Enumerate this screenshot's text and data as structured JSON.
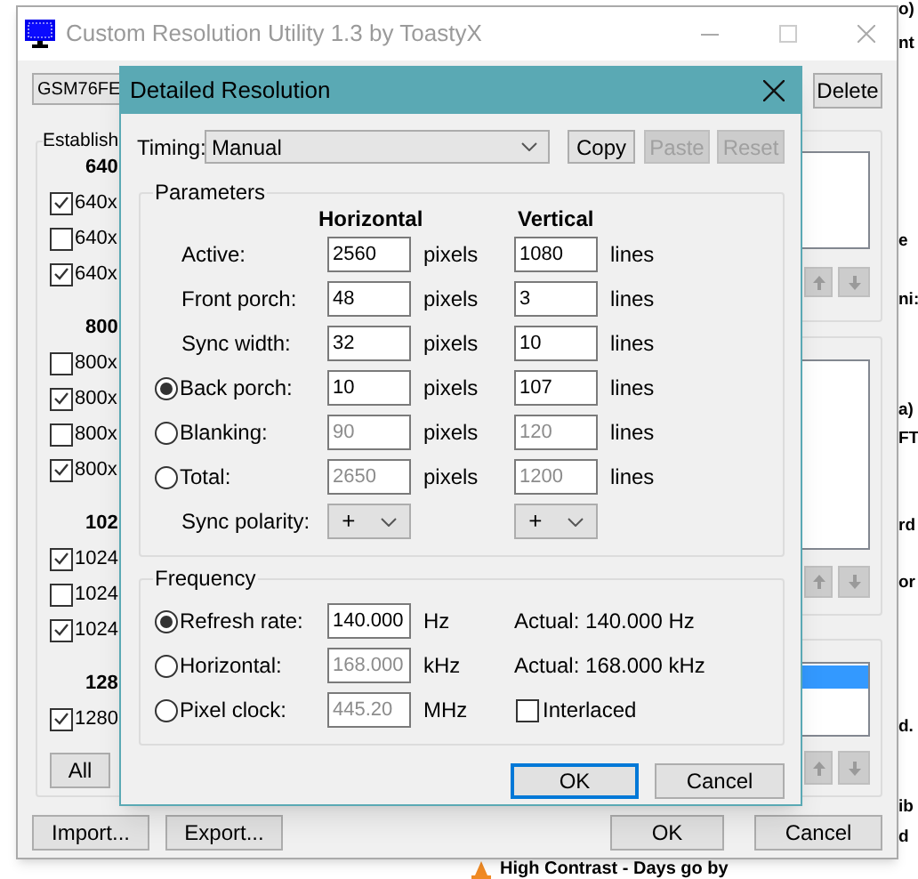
{
  "background_page": {
    "fragments": [
      "o)",
      "nt",
      "e",
      "ni:",
      "a)",
      "FT",
      "rd",
      "or",
      "d.",
      "ib",
      "d"
    ],
    "footer": "High Contrast - Days go by"
  },
  "main_window": {
    "title": "Custom Resolution Utility 1.3 by ToastyX",
    "active": false,
    "monitor": "GSM76FE",
    "delete_button": "Delete",
    "established": {
      "label": "Establish",
      "groups": [
        {
          "header": "640",
          "items": [
            {
              "label": "640x",
              "checked": true
            },
            {
              "label": "640x",
              "checked": false
            },
            {
              "label": "640x",
              "checked": true
            }
          ]
        },
        {
          "header": "800",
          "items": [
            {
              "label": "800x",
              "checked": false
            },
            {
              "label": "800x",
              "checked": true
            },
            {
              "label": "800x",
              "checked": false
            },
            {
              "label": "800x",
              "checked": true
            }
          ]
        },
        {
          "header": "102",
          "items": [
            {
              "label": "1024",
              "checked": true
            },
            {
              "label": "1024",
              "checked": false
            },
            {
              "label": "1024",
              "checked": true
            }
          ]
        },
        {
          "header": "128",
          "items": [
            {
              "label": "1280",
              "checked": true
            }
          ]
        }
      ],
      "all_button": "All"
    },
    "lists": [
      {
        "highlighted_row": false
      },
      {
        "highlighted_row": false
      },
      {
        "highlighted_row": true
      }
    ],
    "import_button": "Import...",
    "export_button": "Export...",
    "ok_button": "OK",
    "cancel_button": "Cancel"
  },
  "dialog": {
    "title": "Detailed Resolution",
    "active": true,
    "timing": {
      "label": "Timing:",
      "value": "Manual"
    },
    "buttons": [
      {
        "label": "Copy",
        "disabled": false
      },
      {
        "label": "Paste",
        "disabled": true
      },
      {
        "label": "Reset",
        "disabled": true
      }
    ],
    "parameters": {
      "label": "Parameters",
      "columns": [
        "Horizontal",
        "Vertical"
      ],
      "rows": [
        {
          "kind": "fields",
          "label": "Active:",
          "horizontal": {
            "value": "2560",
            "disabled": false
          },
          "horizontal_unit": "pixels",
          "vertical": {
            "value": "1080",
            "disabled": false
          },
          "vertical_unit": "lines"
        },
        {
          "kind": "fields",
          "label": "Front porch:",
          "horizontal": {
            "value": "48",
            "disabled": false
          },
          "horizontal_unit": "pixels",
          "vertical": {
            "value": "3",
            "disabled": false
          },
          "vertical_unit": "lines"
        },
        {
          "kind": "fields",
          "label": "Sync width:",
          "horizontal": {
            "value": "32",
            "disabled": false
          },
          "horizontal_unit": "pixels",
          "vertical": {
            "value": "10",
            "disabled": false
          },
          "vertical_unit": "lines"
        },
        {
          "kind": "radio_fields",
          "selected": true,
          "label": "Back porch:",
          "horizontal": {
            "value": "10",
            "disabled": false
          },
          "horizontal_unit": "pixels",
          "vertical": {
            "value": "107",
            "disabled": false
          },
          "vertical_unit": "lines"
        },
        {
          "kind": "radio_fields",
          "selected": false,
          "label": "Blanking:",
          "horizontal": {
            "value": "90",
            "disabled": true
          },
          "horizontal_unit": "pixels",
          "vertical": {
            "value": "120",
            "disabled": true
          },
          "vertical_unit": "lines"
        },
        {
          "kind": "radio_fields",
          "selected": false,
          "label": "Total:",
          "horizontal": {
            "value": "2650",
            "disabled": true
          },
          "horizontal_unit": "pixels",
          "vertical": {
            "value": "1200",
            "disabled": true
          },
          "vertical_unit": "lines"
        },
        {
          "kind": "polarity",
          "label": "Sync polarity:",
          "horizontal": "+",
          "vertical": "+"
        }
      ]
    },
    "frequency": {
      "label": "Frequency",
      "rows": [
        {
          "label": "Refresh rate:",
          "selected": true,
          "value": "140.000",
          "disabled": false,
          "unit": "Hz",
          "extra": {
            "kind": "text",
            "text": "Actual: 140.000 Hz"
          }
        },
        {
          "label": "Horizontal:",
          "selected": false,
          "value": "168.000",
          "disabled": true,
          "unit": "kHz",
          "extra": {
            "kind": "text",
            "text": "Actual: 168.000 kHz"
          }
        },
        {
          "label": "Pixel clock:",
          "selected": false,
          "value": "445.20",
          "disabled": true,
          "unit": "MHz",
          "extra": {
            "kind": "checkbox",
            "label": "Interlaced",
            "checked": false
          }
        }
      ]
    },
    "ok_button": {
      "label": "OK",
      "default": true
    },
    "cancel_button": {
      "label": "Cancel",
      "default": false
    }
  }
}
